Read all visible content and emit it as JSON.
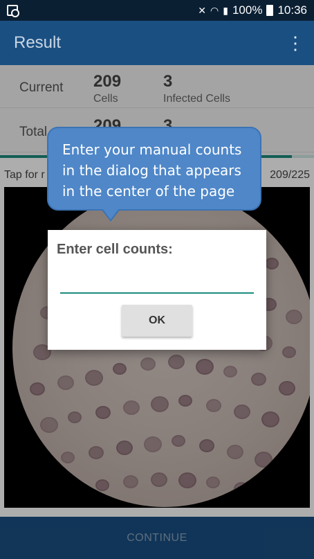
{
  "status_bar": {
    "battery_percent": "100%",
    "time": "10:36",
    "icons": [
      "notification-icon",
      "mute-icon",
      "wifi-icon",
      "signal-icon",
      "battery-icon"
    ]
  },
  "app_bar": {
    "title": "Result",
    "menu_icon": "more-vert-icon"
  },
  "counts": {
    "current": {
      "label": "Current",
      "cells": "209",
      "cells_label": "Cells",
      "infected": "3",
      "infected_label": "Infected Cells"
    },
    "total": {
      "label": "Total",
      "cells": "209",
      "infected": "3"
    }
  },
  "progress": {
    "value": 209,
    "max": 225,
    "tap_text": "Tap for r",
    "ratio_text": "209/225"
  },
  "dialog": {
    "title": "Enter cell counts:",
    "input_value": "",
    "ok_label": "OK"
  },
  "callout": {
    "text": "Enter your manual counts in the dialog that appears in the center of the page"
  },
  "bottom_bar": {
    "continue_label": "CONTINUE"
  },
  "colors": {
    "app_bar": "#1a4f82",
    "accent": "#1b8b7c",
    "callout": "#4f87c8"
  }
}
